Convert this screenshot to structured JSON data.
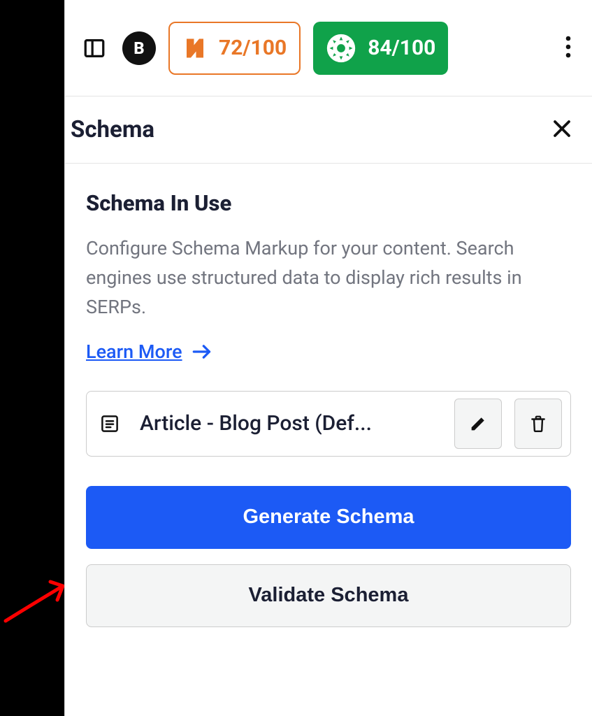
{
  "toolbar": {
    "badge_letter": "B",
    "score_orange": "72/100",
    "score_green": "84/100"
  },
  "panel": {
    "title": "Schema"
  },
  "section": {
    "title": "Schema In Use",
    "description": "Configure Schema Markup for your content. Search engines use structured data to display rich results in SERPs.",
    "learn_more_label": "Learn More"
  },
  "schema_item": {
    "label": "Article - Blog Post (Def..."
  },
  "buttons": {
    "generate": "Generate Schema",
    "validate": "Validate Schema"
  }
}
